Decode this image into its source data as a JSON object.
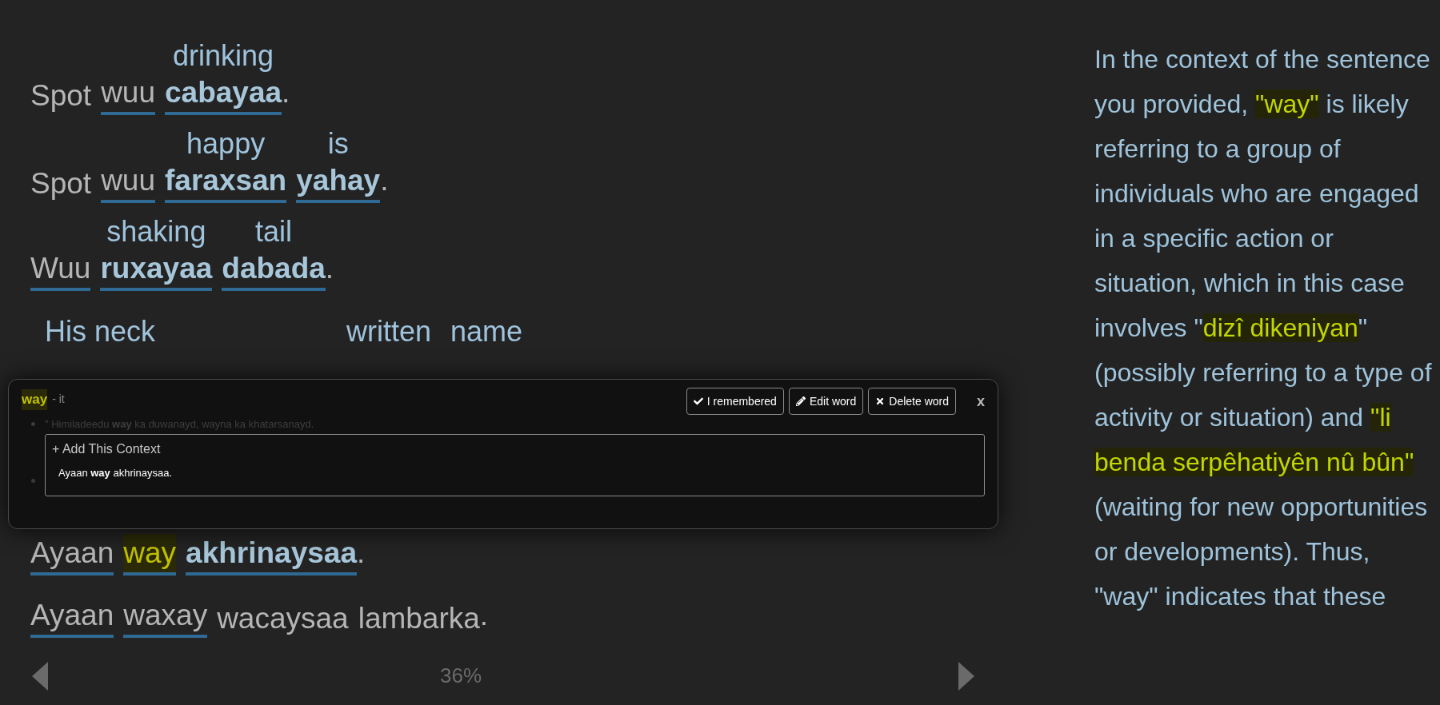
{
  "reader": {
    "sentences": [
      {
        "words": [
          {
            "text": "Spot",
            "kind": "plain"
          },
          {
            "text": "wuu",
            "kind": "known"
          },
          {
            "text": "cabayaa",
            "kind": "learning",
            "gloss": "drinking"
          }
        ],
        "end": "."
      },
      {
        "words": [
          {
            "text": "Spot",
            "kind": "plain"
          },
          {
            "text": "wuu",
            "kind": "known"
          },
          {
            "text": "faraxsan",
            "kind": "learning",
            "gloss": "happy"
          },
          {
            "text": "yahay",
            "kind": "learning",
            "gloss": "is"
          }
        ],
        "end": "."
      },
      {
        "words": [
          {
            "text": "Wuu",
            "kind": "known"
          },
          {
            "text": "ruxayaa",
            "kind": "learning",
            "gloss": "shaking"
          },
          {
            "text": "dabada",
            "kind": "learning",
            "gloss": "tail"
          }
        ],
        "end": "."
      }
    ],
    "covered_glosses": [
      "His neck",
      "written",
      "name"
    ],
    "lower_sentences": [
      {
        "words": [
          {
            "text": "Ayaan",
            "kind": "known"
          },
          {
            "text": "way",
            "kind": "selected"
          },
          {
            "text": "akhrinaysaa",
            "kind": "learning"
          }
        ],
        "end": "."
      },
      {
        "words": [
          {
            "text": "Ayaan",
            "kind": "known"
          },
          {
            "text": "waxay",
            "kind": "known"
          },
          {
            "text": "wacaysaa",
            "kind": "plain"
          },
          {
            "text": "lambarka",
            "kind": "plain"
          }
        ],
        "end": "."
      }
    ],
    "progress": "36%"
  },
  "popup": {
    "word": "way",
    "meaning": "- it",
    "buttons": [
      {
        "label": "I remembered",
        "kind": "remembered"
      },
      {
        "label": "Edit word",
        "kind": "edit"
      },
      {
        "label": "Delete word",
        "kind": "delete"
      }
    ],
    "close": "x",
    "contexts": [
      "\" Himiladeedu **way** ka duwanayd, wayna ka khatarsanayd."
    ],
    "add_context": {
      "title": "+ Add This Context",
      "sentence": "Ayaan **way** akhrinaysaa."
    }
  },
  "explanation": {
    "segments": [
      {
        "text": "In the context of the sentence you provided, ",
        "highlight": false
      },
      {
        "text": "\"way\"",
        "highlight": true
      },
      {
        "text": " is likely referring to a group of individuals who are engaged in a specific action or situation, which in this case involves \"",
        "highlight": false
      },
      {
        "text": "dizî dikeniyan",
        "highlight": true
      },
      {
        "text": "\" (possibly referring to a type of activity or situation) and ",
        "highlight": false
      },
      {
        "text": "\"li benda serpêhatiyên nû bûn\"",
        "highlight": true
      },
      {
        "text": " (waiting for new opportunities or developments). Thus, \"way\" indicates that these",
        "highlight": false
      }
    ]
  }
}
